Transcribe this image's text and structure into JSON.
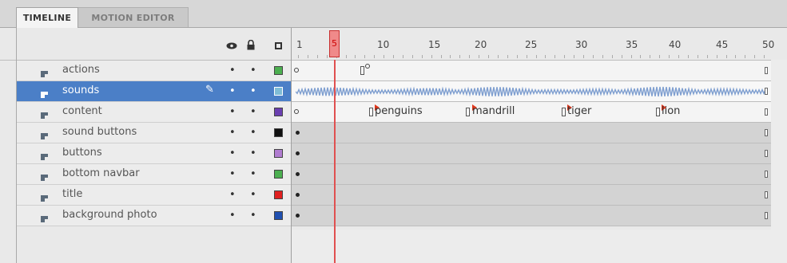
{
  "tabs": [
    {
      "label": "TIMELINE",
      "active": true
    },
    {
      "label": "MOTION EDITOR",
      "active": false
    }
  ],
  "header": {
    "eye_icon": "eye-icon",
    "lock_icon": "lock-icon",
    "outline_icon": "outline-icon"
  },
  "ruler": {
    "current_frame": "5",
    "numbers": [
      "1",
      "10",
      "15",
      "20",
      "25",
      "30",
      "35",
      "40",
      "45",
      "50"
    ]
  },
  "layers": [
    {
      "name": "actions",
      "color": "#4caf50",
      "selected": false
    },
    {
      "name": "sounds",
      "color": "#7fbcd6",
      "selected": true
    },
    {
      "name": "content",
      "color": "#6a3fb0",
      "selected": false
    },
    {
      "name": "sound buttons",
      "color": "#111111",
      "selected": false
    },
    {
      "name": "buttons",
      "color": "#b07cd0",
      "selected": false
    },
    {
      "name": "bottom navbar",
      "color": "#4caf50",
      "selected": false
    },
    {
      "name": "title",
      "color": "#e02020",
      "selected": false
    },
    {
      "name": "background photo",
      "color": "#2050b0",
      "selected": false
    }
  ],
  "frame_labels": [
    "penguins",
    "mandrill",
    "tiger",
    "lion"
  ],
  "colors": {
    "selection": "#4b7fc7",
    "playhead": "#e05050",
    "label_flag": "#e0361b"
  }
}
